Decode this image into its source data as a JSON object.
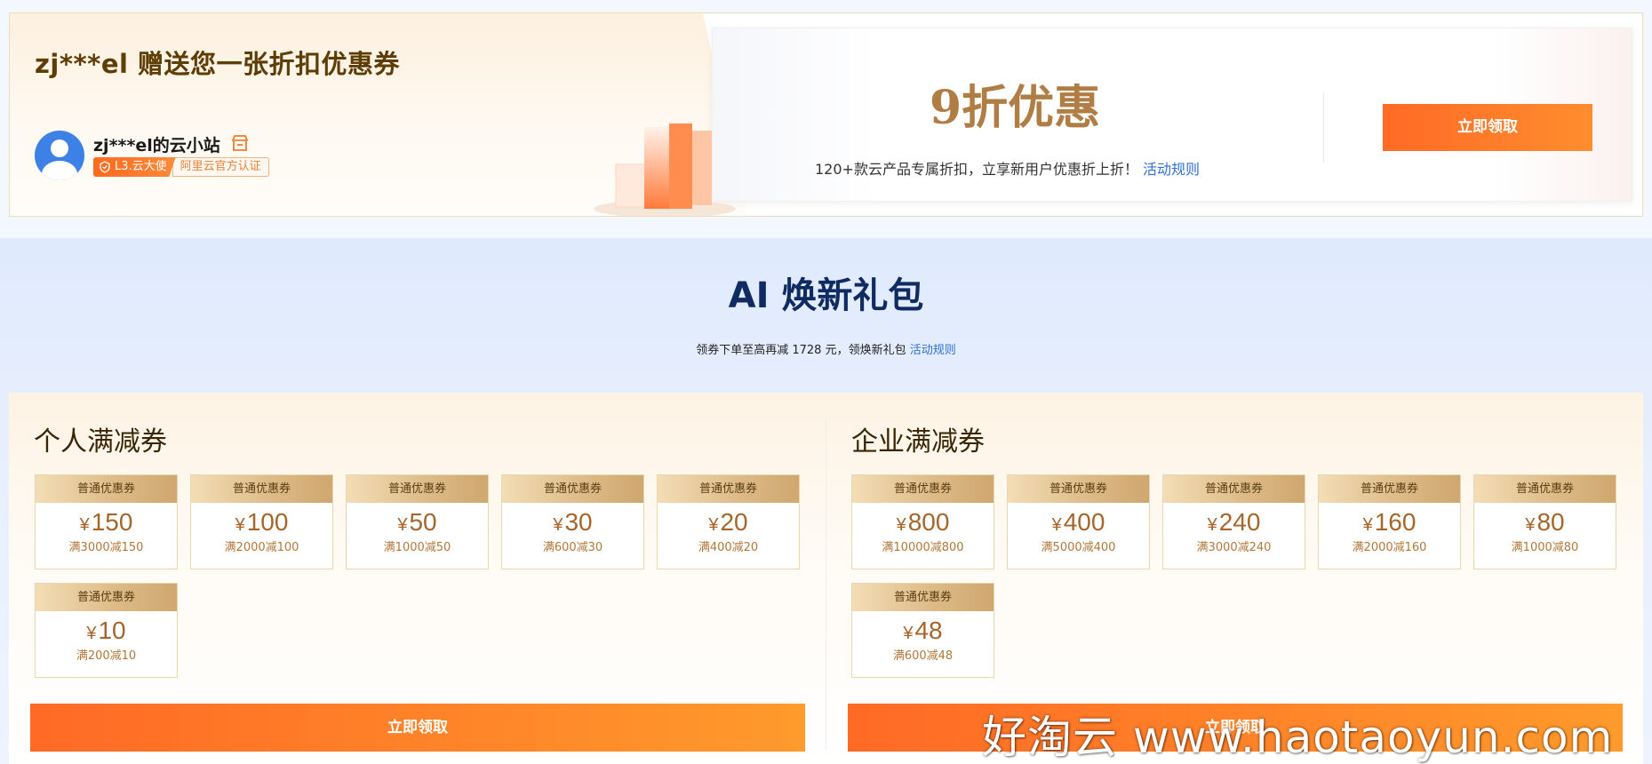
{
  "promo": {
    "title": "zj***el 赠送您一张折扣优惠券",
    "store_name": "zj***el的云小站",
    "level_badge": "L3.云大使",
    "cert_badge": "阿里云官方认证",
    "discount_title": "9折优惠",
    "discount_desc": "120+款云产品专属折扣，立享新用户优惠折上折！",
    "rule_link": "活动规则",
    "claim_label": "立即领取"
  },
  "gift": {
    "title": "AI 焕新礼包",
    "subtitle": "领券下单至高再减 1728 元，领焕新礼包",
    "rule_link": "活动规则"
  },
  "personal": {
    "title": "个人满减券",
    "coupons": [
      {
        "type": "普通优惠券",
        "amount": "150",
        "cond": "满3000减150"
      },
      {
        "type": "普通优惠券",
        "amount": "100",
        "cond": "满2000减100"
      },
      {
        "type": "普通优惠券",
        "amount": "50",
        "cond": "满1000减50"
      },
      {
        "type": "普通优惠券",
        "amount": "30",
        "cond": "满600减30"
      },
      {
        "type": "普通优惠券",
        "amount": "20",
        "cond": "满400减20"
      },
      {
        "type": "普通优惠券",
        "amount": "10",
        "cond": "满200减10"
      }
    ],
    "claim_label": "立即领取"
  },
  "enterprise": {
    "title": "企业满减券",
    "coupons": [
      {
        "type": "普通优惠券",
        "amount": "800",
        "cond": "满10000减800"
      },
      {
        "type": "普通优惠券",
        "amount": "400",
        "cond": "满5000减400"
      },
      {
        "type": "普通优惠券",
        "amount": "240",
        "cond": "满3000减240"
      },
      {
        "type": "普通优惠券",
        "amount": "160",
        "cond": "满2000减160"
      },
      {
        "type": "普通优惠券",
        "amount": "80",
        "cond": "满1000减80"
      },
      {
        "type": "普通优惠券",
        "amount": "48",
        "cond": "满600减48"
      }
    ],
    "claim_label": "立即领取"
  },
  "currency_symbol": "¥",
  "watermark": "好淘云 www.haotaoyun.com",
  "colors": {
    "accent_orange": "#ff6a25",
    "gold_text": "#b07d45",
    "link_blue": "#2f6fd6",
    "title_navy": "#102b61"
  }
}
